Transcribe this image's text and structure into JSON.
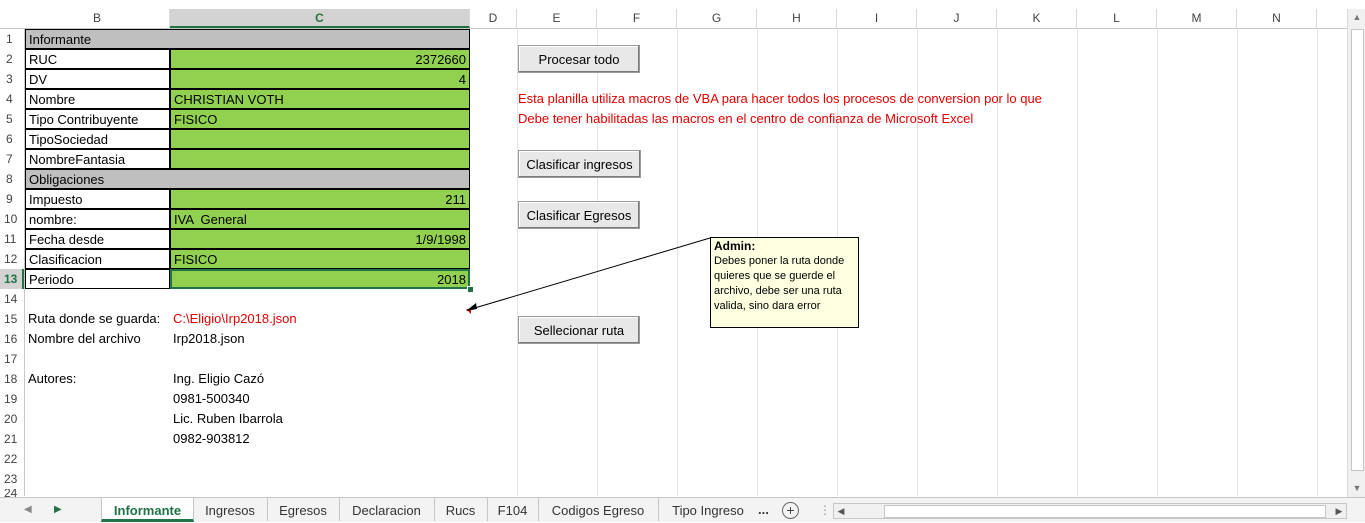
{
  "column_headers": [
    "B",
    "C",
    "D",
    "E",
    "F",
    "G",
    "H",
    "I",
    "J",
    "K",
    "L",
    "M",
    "N"
  ],
  "row_numbers": [
    "1",
    "2",
    "3",
    "4",
    "5",
    "6",
    "7",
    "8",
    "9",
    "10",
    "11",
    "12",
    "13",
    "14",
    "15",
    "16",
    "17",
    "18",
    "19",
    "20",
    "21",
    "22",
    "23",
    "24"
  ],
  "rows": {
    "r1": {
      "b": "Informante"
    },
    "r2": {
      "b": "RUC",
      "c": "2372660"
    },
    "r3": {
      "b": "DV",
      "c": "4"
    },
    "r4": {
      "b": "Nombre",
      "c": "CHRISTIAN VOTH"
    },
    "r5": {
      "b": "Tipo Contribuyente",
      "c": "FISICO"
    },
    "r6": {
      "b": "TipoSociedad",
      "c": ""
    },
    "r7": {
      "b": "NombreFantasia",
      "c": ""
    },
    "r8": {
      "b": "Obligaciones"
    },
    "r9": {
      "b": "Impuesto",
      "c": "211"
    },
    "r10": {
      "b": "nombre:",
      "c": "IVA  General"
    },
    "r11": {
      "b": "Fecha desde",
      "c": "1/9/1998"
    },
    "r12": {
      "b": "Clasificacion",
      "c": "FISICO"
    },
    "r13": {
      "b": "Periodo",
      "c": "2018"
    },
    "r15": {
      "b": "Ruta donde se guarda:",
      "c": "C:\\Eligio\\Irp2018.json"
    },
    "r16": {
      "b": "Nombre del archivo",
      "c": "Irp2018.json"
    },
    "r18": {
      "b": "Autores:",
      "c": "Ing. Eligio Cazó"
    },
    "r19": {
      "c": "0981-500340"
    },
    "r20": {
      "c": "Lic. Ruben Ibarrola"
    },
    "r21": {
      "c": "0982-903812"
    }
  },
  "buttons": {
    "procesar": "Procesar todo",
    "clasificar_ingresos": "Clasificar ingresos",
    "clasificar_egresos": "Clasificar Egresos",
    "seleccionar_ruta": "Sellecionar ruta"
  },
  "notice": {
    "line1": "Esta planilla utiliza macros de VBA para hacer todos los procesos de conversion por lo que",
    "line2": "Debe tener habilitadas las macros en el centro de confianza de Microsoft Excel"
  },
  "comment": {
    "author": "Admin:",
    "text": "Debes poner la ruta donde quieres que se guerde el archivo, debe ser una ruta valida, sino dara error"
  },
  "sheet_tabs": [
    "Informante",
    "Ingresos",
    "Egresos",
    "Declaracion",
    "Rucs",
    "F104",
    "Codigos Egreso",
    "Tipo Ingreso"
  ],
  "tabs_more": "...",
  "add_sheet": "+",
  "colors": {
    "green_fill": "#92d050",
    "section_fill": "#bfbfbf",
    "accent": "#217346",
    "notice_red": "#e20000",
    "comment_bg": "#ffffe1"
  }
}
